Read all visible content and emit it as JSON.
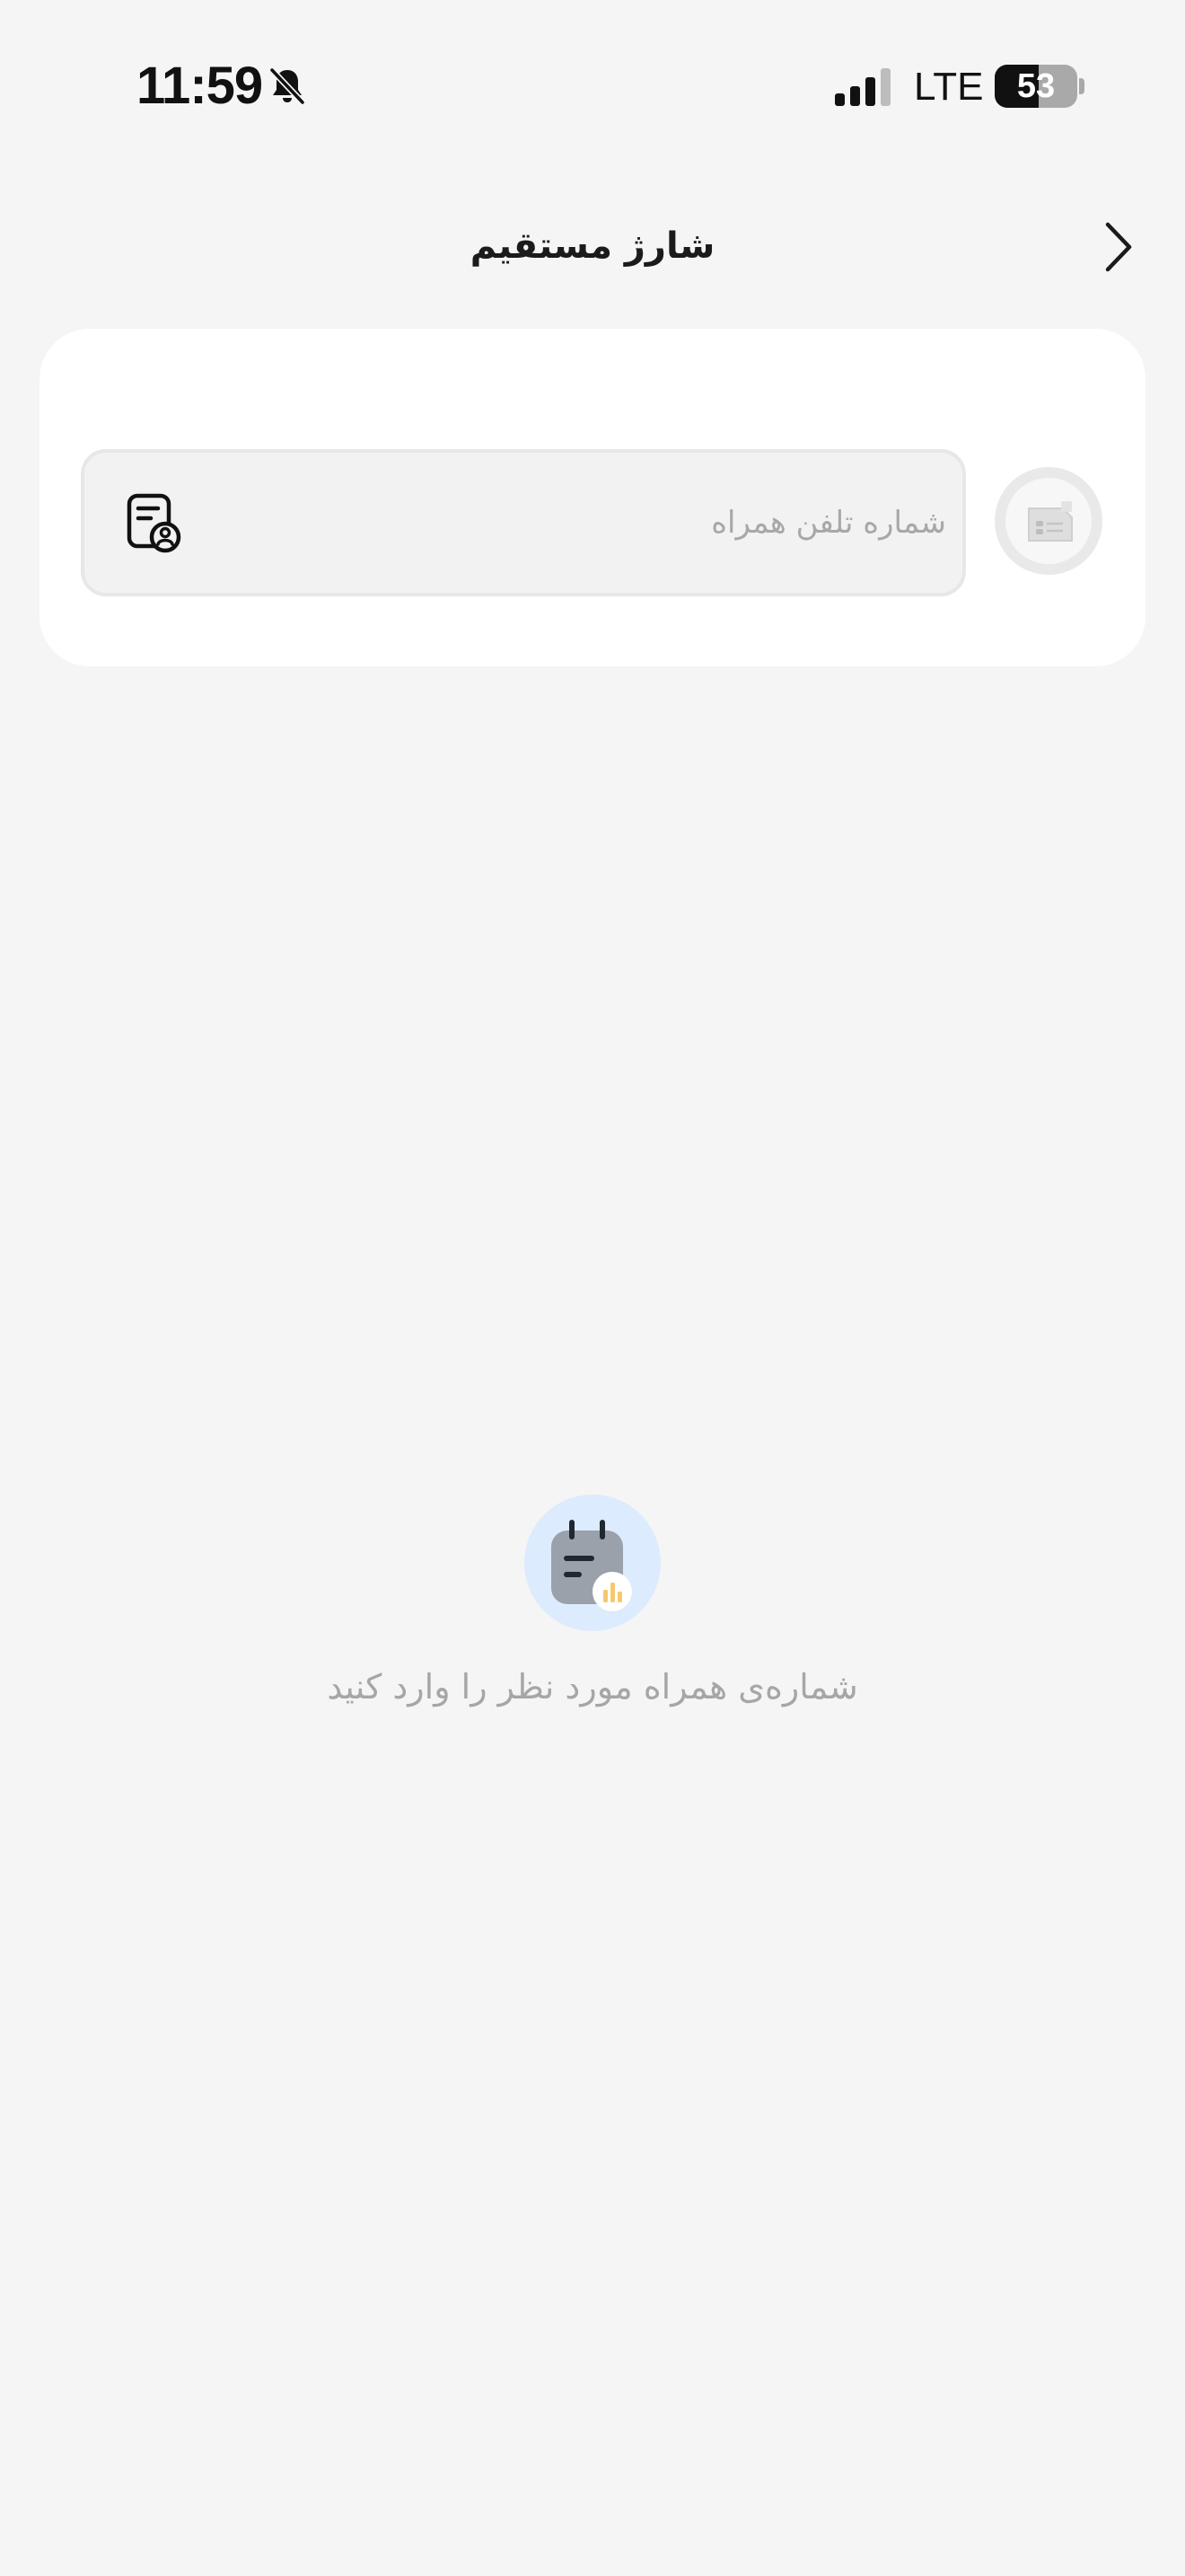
{
  "status_bar": {
    "time": "11:59",
    "mute_icon": "bell-slash-icon",
    "signal_icon": "cellular-signal-icon",
    "network": "LTE",
    "battery_level": 53,
    "battery_text": "53"
  },
  "header": {
    "title": "شارژ مستقیم",
    "back_icon": "chevron-right-icon"
  },
  "form": {
    "phone_placeholder": "شماره تلفن همراه",
    "phone_value": "",
    "contacts_icon": "contact-list-icon",
    "operator_icon": "sim-card-icon"
  },
  "empty_state": {
    "icon": "calendar-chart-icon",
    "message": "شماره‌ی همراه مورد نظر را وارد کنید"
  },
  "colors": {
    "background": "#f5f5f5",
    "card": "#ffffff",
    "empty_icon_bg": "#dcebfd",
    "accent": "#f6c86e"
  }
}
